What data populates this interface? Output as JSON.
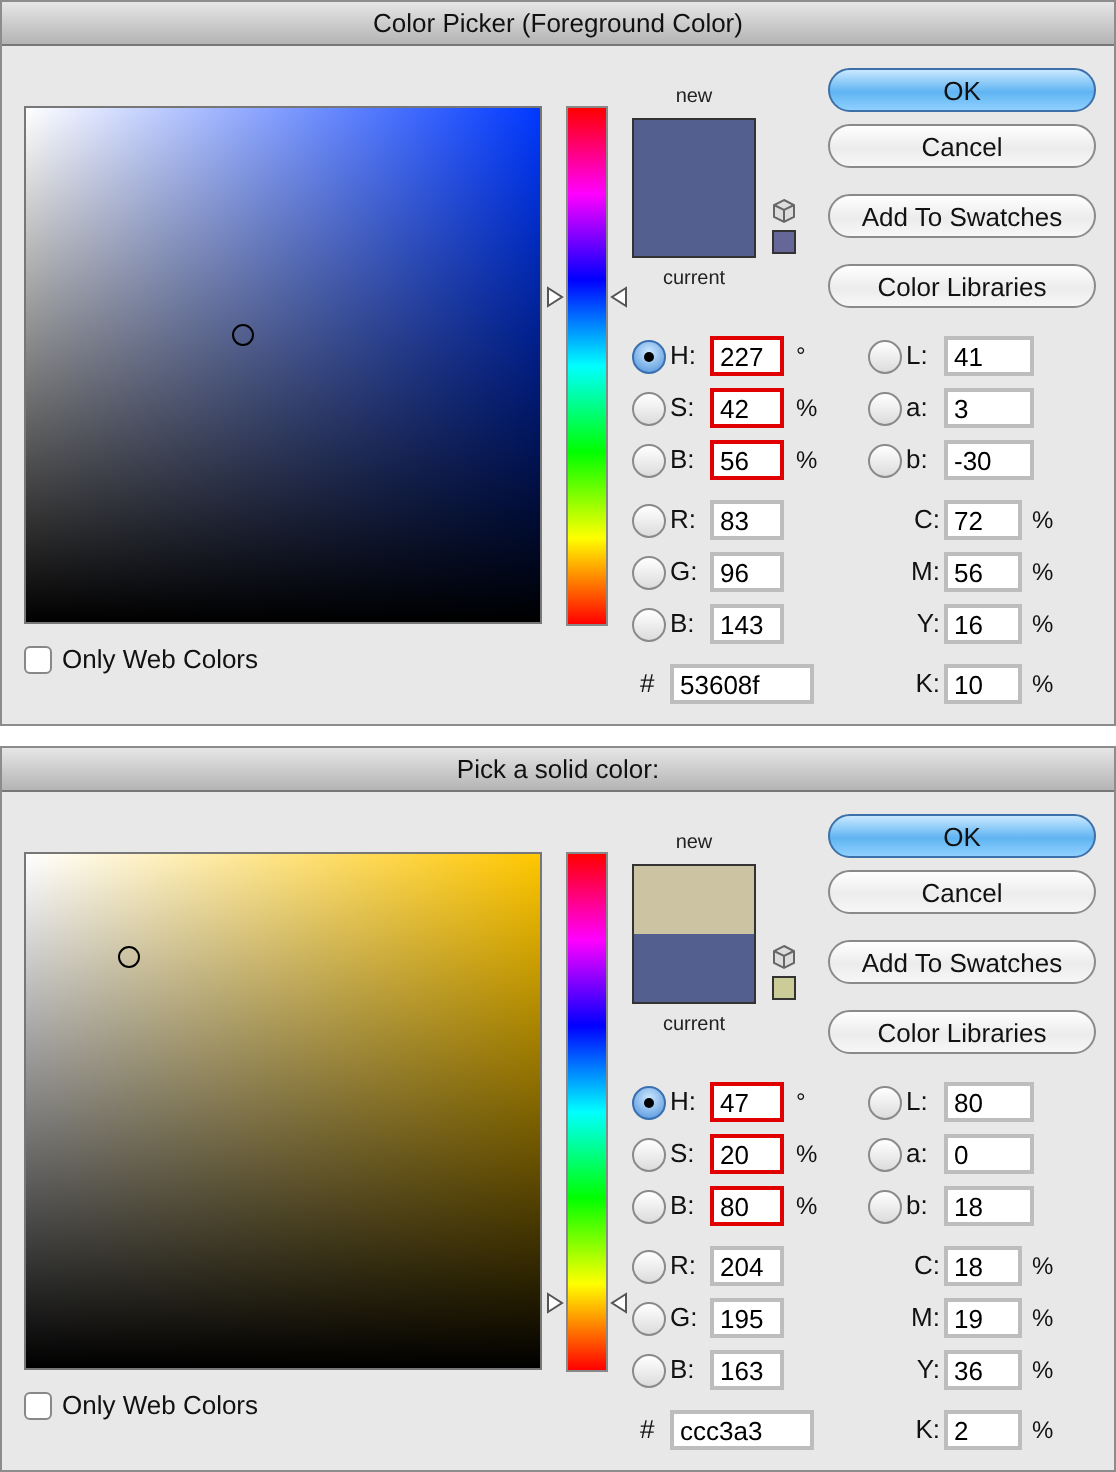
{
  "dialogs": [
    {
      "title": "Color Picker (Foreground Color)",
      "hue_slider": {
        "level": 0.63
      },
      "only_web_colors": {
        "label": "Only Web Colors",
        "checked": false
      },
      "preview": {
        "new_label": "new",
        "current_label": "current",
        "new_swatch": {
          "color": "#53608f"
        },
        "current_swatch": {
          "color": "#53608f"
        }
      },
      "web_safe_swatch": {
        "color": "#666699"
      },
      "buttons": [
        {
          "label": "OK",
          "default": true
        },
        {
          "label": "Cancel",
          "default": false
        },
        {
          "label": "Add To Swatches",
          "default": false
        },
        {
          "label": "Color Libraries",
          "default": false
        }
      ],
      "fields_left": [
        {
          "kind": "radio",
          "label": "H:",
          "value": "227",
          "unit": "°",
          "selected": true,
          "highlighted": true
        },
        {
          "kind": "radio",
          "label": "S:",
          "value": "42",
          "unit": "%",
          "selected": false,
          "highlighted": true
        },
        {
          "kind": "radio",
          "label": "B:",
          "value": "56",
          "unit": "%",
          "selected": false,
          "highlighted": true
        },
        {
          "kind": "radio",
          "label": "R:",
          "value": "83",
          "selected": false,
          "highlighted": false
        },
        {
          "kind": "radio",
          "label": "G:",
          "value": "96",
          "selected": false,
          "highlighted": false
        },
        {
          "kind": "radio",
          "label": "B:",
          "value": "143",
          "selected": false,
          "highlighted": false
        },
        {
          "kind": "hex",
          "label": "#",
          "value": "53608f"
        }
      ],
      "fields_right": [
        {
          "kind": "radio",
          "label": "L:",
          "value": "41",
          "selected": false
        },
        {
          "kind": "radio",
          "label": "a:",
          "value": "3",
          "selected": false
        },
        {
          "kind": "radio",
          "label": "b:",
          "value": "-30",
          "selected": false
        },
        {
          "kind": "plain",
          "label": "C:",
          "value": "72",
          "unit": "%"
        },
        {
          "kind": "plain",
          "label": "M:",
          "value": "56",
          "unit": "%"
        },
        {
          "kind": "plain",
          "label": "Y:",
          "value": "16",
          "unit": "%"
        },
        {
          "kind": "plain",
          "label": "K:",
          "value": "10",
          "unit": "%"
        }
      ]
    },
    {
      "title": "Pick a solid color:",
      "hue_slider": {
        "level": 0.13
      },
      "only_web_colors": {
        "label": "Only Web Colors",
        "checked": false
      },
      "preview": {
        "new_label": "new",
        "current_label": "current",
        "new_swatch": {
          "color": "#ccc3a3"
        },
        "current_swatch": {
          "color": "#53608f"
        }
      },
      "web_safe_swatch": {
        "color": "#cccc99"
      },
      "buttons": [
        {
          "label": "OK",
          "default": true
        },
        {
          "label": "Cancel",
          "default": false
        },
        {
          "label": "Add To Swatches",
          "default": false
        },
        {
          "label": "Color Libraries",
          "default": false
        }
      ],
      "fields_left": [
        {
          "kind": "radio",
          "label": "H:",
          "value": "47",
          "unit": "°",
          "selected": true,
          "highlighted": true
        },
        {
          "kind": "radio",
          "label": "S:",
          "value": "20",
          "unit": "%",
          "selected": false,
          "highlighted": true
        },
        {
          "kind": "radio",
          "label": "B:",
          "value": "80",
          "unit": "%",
          "selected": false,
          "highlighted": true
        },
        {
          "kind": "radio",
          "label": "R:",
          "value": "204",
          "selected": false,
          "highlighted": false
        },
        {
          "kind": "radio",
          "label": "G:",
          "value": "195",
          "selected": false,
          "highlighted": false
        },
        {
          "kind": "radio",
          "label": "B:",
          "value": "163",
          "selected": false,
          "highlighted": false
        },
        {
          "kind": "hex",
          "label": "#",
          "value": "ccc3a3"
        }
      ],
      "fields_right": [
        {
          "kind": "radio",
          "label": "L:",
          "value": "80",
          "selected": false
        },
        {
          "kind": "radio",
          "label": "a:",
          "value": "0",
          "selected": false
        },
        {
          "kind": "radio",
          "label": "b:",
          "value": "18",
          "selected": false
        },
        {
          "kind": "plain",
          "label": "C:",
          "value": "18",
          "unit": "%"
        },
        {
          "kind": "plain",
          "label": "M:",
          "value": "19",
          "unit": "%"
        },
        {
          "kind": "plain",
          "label": "Y:",
          "value": "36",
          "unit": "%"
        },
        {
          "kind": "plain",
          "label": "K:",
          "value": "2",
          "unit": "%"
        }
      ]
    }
  ]
}
